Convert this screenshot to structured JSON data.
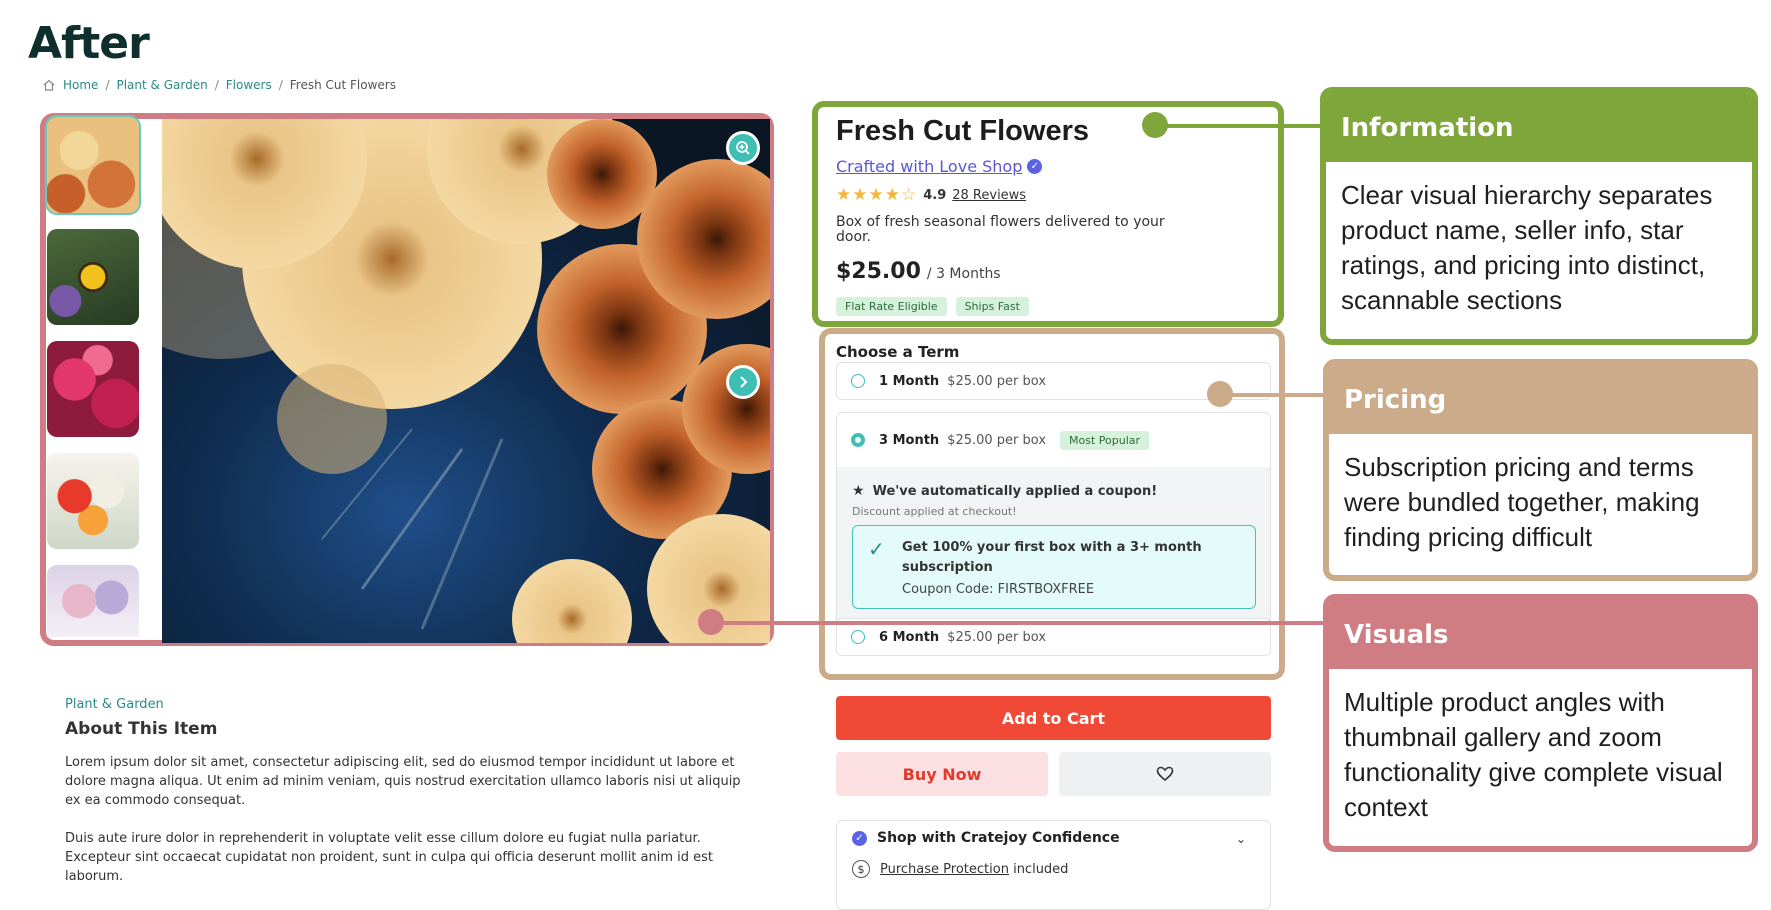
{
  "page_heading": "After",
  "breadcrumb": [
    "Home",
    "Plant & Garden",
    "Flowers",
    "Fresh Cut Flowers"
  ],
  "product": {
    "title": "Fresh Cut Flowers",
    "seller": "Crafted with Love Shop",
    "rating": "4.9",
    "rating_stars": 4.5,
    "reviews": "28 Reviews",
    "description": "Box of fresh seasonal flowers delivered to your door.",
    "price": "$25.00",
    "price_term": "/ 3 Months",
    "chips": [
      "Flat Rate Eligible",
      "Ships Fast"
    ]
  },
  "terms": {
    "heading": "Choose a Term",
    "options": [
      {
        "name": "1 Month",
        "price": "$25.00 per box"
      },
      {
        "name": "3 Month",
        "price": "$25.00 per box",
        "badge": "Most Popular"
      },
      {
        "name": "6 Month",
        "price": "$25.00 per box"
      }
    ],
    "selected_option": "3 Month",
    "coupon_heading": "We've automatically applied a coupon!",
    "coupon_sub": "Discount applied at checkout!",
    "coupon_offer": "Get 100% your first box with a 3+ month subscription",
    "coupon_code": "Coupon Code: FIRSTBOXFREE"
  },
  "buttons": {
    "add_to_cart": "Add to Cart",
    "buy_now": "Buy Now"
  },
  "confidence": {
    "heading": "Shop with Cratejoy Confidence",
    "protection_link": "Purchase Protection",
    "protection_suffix": "included"
  },
  "about": {
    "category": "Plant & Garden",
    "title": "About This Item",
    "paragraphs": [
      "Lorem ipsum dolor sit amet, consectetur adipiscing elit, sed do eiusmod tempor incididunt ut labore et dolore magna aliqua. Ut enim ad minim veniam, quis nostrud exercitation ullamco laboris nisi ut aliquip ex ea commodo consequat.",
      "Duis aute irure dolor in reprehenderit in voluptate velit esse cillum dolore eu fugiat nulla pariatur. Excepteur sint occaecat cupidatat non proident, sunt in culpa qui officia deserunt mollit anim id est laborum."
    ]
  },
  "annotations": [
    {
      "title": "Information",
      "body": "Clear visual hierarchy separates product name, seller info, star ratings, and pricing into distinct, scannable sections",
      "color": "#7fa63a"
    },
    {
      "title": "Pricing",
      "body": "Subscription pricing and terms were bundled together, making finding pricing difficult",
      "color": "#cbab8a"
    },
    {
      "title": "Visuals",
      "body": "Multiple product angles with thumbnail gallery and zoom functionality give complete visual context",
      "color": "#cf7c82"
    }
  ],
  "colors": {
    "accent_teal": "#3fbfb4",
    "cta_red": "#f04a37",
    "seller_link": "#5a55d8",
    "star": "#f4b63a"
  }
}
